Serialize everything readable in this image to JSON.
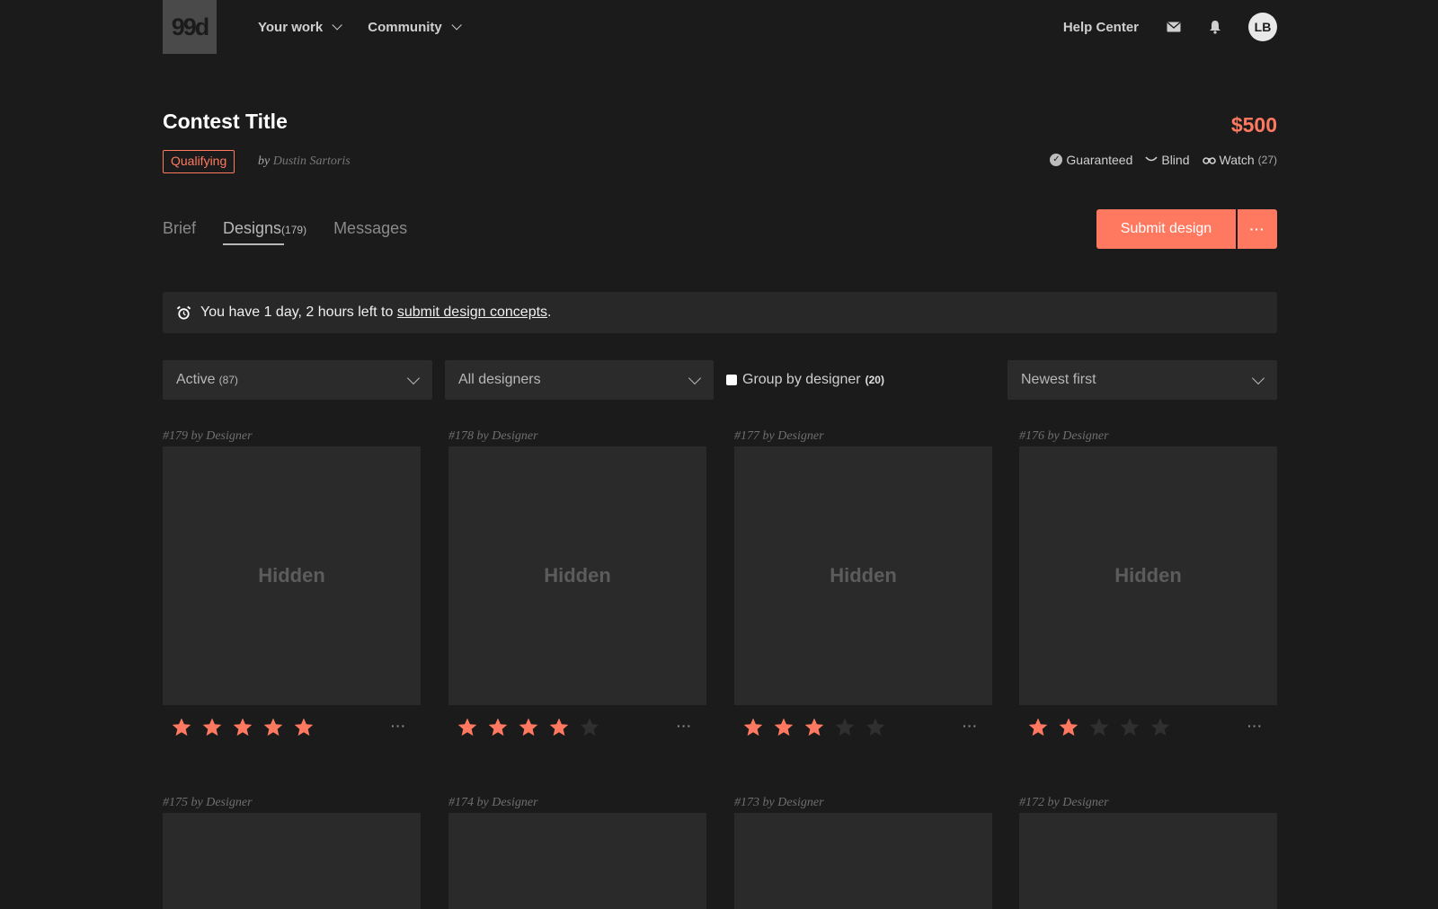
{
  "nav": {
    "logo": "99d",
    "your_work": "Your work",
    "community": "Community",
    "help_center": "Help Center",
    "avatar_initials": "LB"
  },
  "contest": {
    "title": "Contest Title",
    "prize": "$500",
    "status": "Qualifying",
    "by_prefix": "by",
    "author": "Dustin Sartoris",
    "guaranteed": "Guaranteed",
    "blind": "Blind",
    "watch": "Watch",
    "watch_count": "(27)"
  },
  "tabs": {
    "brief": "Brief",
    "designs": "Designs",
    "designs_count": "(179)",
    "messages": "Messages"
  },
  "actions": {
    "submit": "Submit design",
    "more": "···"
  },
  "notice": {
    "prefix": "You have 1 day, 2 hours left to ",
    "link": "submit design concepts",
    "suffix": "."
  },
  "filters": {
    "status_value": "Active",
    "status_count": "(87)",
    "designer_value": "All designers",
    "group_label": "Group by designer",
    "group_count": "(20)",
    "sort_value": "Newest first"
  },
  "accent_color": "#ff7961",
  "cards": [
    {
      "label": "#179 by Designer",
      "thumb": "Hidden",
      "rating": 5
    },
    {
      "label": "#178 by Designer",
      "thumb": "Hidden",
      "rating": 4
    },
    {
      "label": "#177 by Designer",
      "thumb": "Hidden",
      "rating": 3
    },
    {
      "label": "#176 by Designer",
      "thumb": "Hidden",
      "rating": 2
    },
    {
      "label": "#175 by Designer",
      "thumb": "",
      "rating": 0
    },
    {
      "label": "#174 by Designer",
      "thumb": "",
      "rating": 0
    },
    {
      "label": "#173 by Designer",
      "thumb": "",
      "rating": 0
    },
    {
      "label": "#172 by Designer",
      "thumb": "",
      "rating": 0
    }
  ],
  "card_more": "···"
}
